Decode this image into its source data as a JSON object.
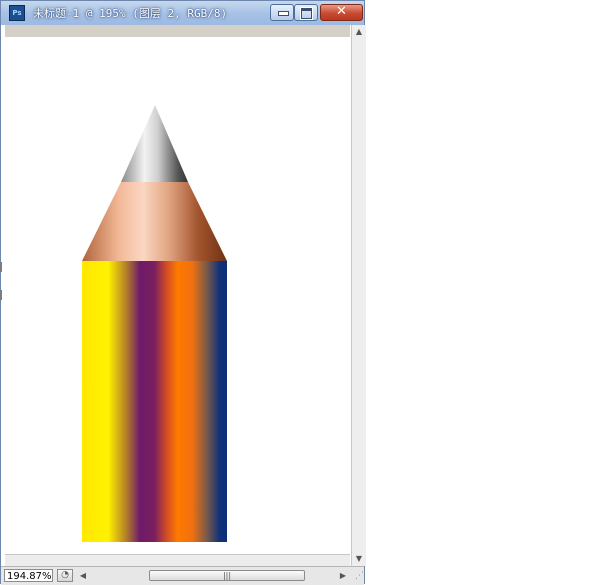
{
  "window": {
    "title": "未标题-1 @ 195% (图层 2, RGB/8)",
    "app_icon_label": "Ps",
    "close_symbol": "✕"
  },
  "statusbar": {
    "zoom": "194.87%"
  },
  "icons": {
    "app": "photoshop-icon",
    "minimize": "minimize-icon",
    "maximize": "maximize-icon",
    "close": "close-icon",
    "scroll_up": "arrow-up-icon",
    "scroll_down": "arrow-down-icon",
    "scroll_left": "arrow-left-icon",
    "scroll_right": "arrow-right-icon",
    "status_menu": "status-menu-icon"
  },
  "colors": {
    "pencil_stripes": [
      "#fff000",
      "#6e1a6a",
      "#ff7a00",
      "#10317a"
    ],
    "wood": "#f6c7a8",
    "wood_shadow": "#7a3a18",
    "graphite_light": "#e8e8e8",
    "graphite_dark": "#404040",
    "title_bar": "#a8c2e6",
    "close_button": "#c94a33"
  }
}
